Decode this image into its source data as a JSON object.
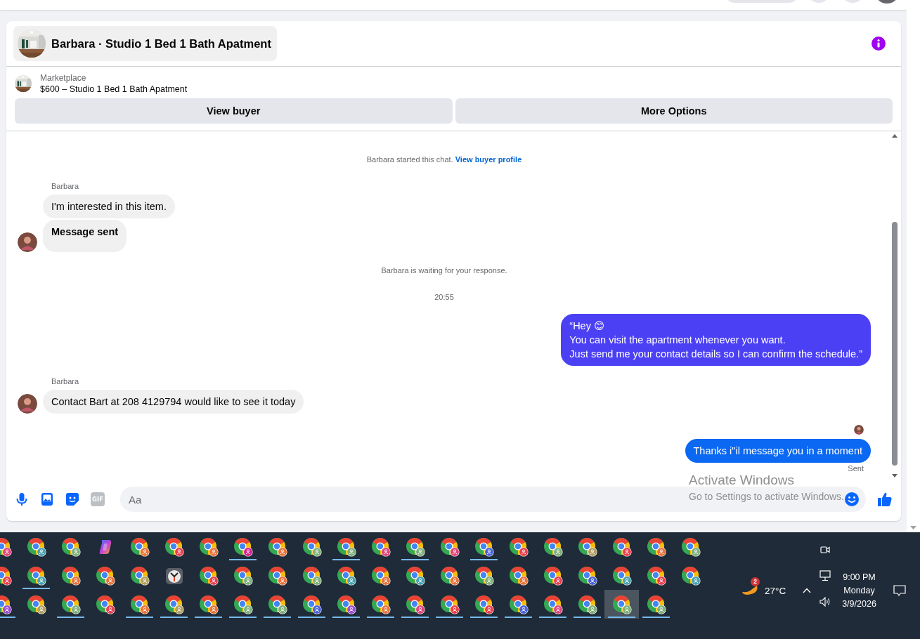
{
  "chat": {
    "title": "Barbara · Studio 1 Bed 1 Bath Apatment",
    "listing": {
      "source": "Marketplace",
      "summary": "$600 – Studio 1 Bed 1 Bath Apatment"
    },
    "buttons": [
      "View buyer",
      "More Options"
    ],
    "messages": [
      {
        "kind": "notice",
        "text": "Barbara started this chat.",
        "link": "View buyer profile"
      },
      {
        "kind": "incoming",
        "sender": "Barbara",
        "bubbles": [
          {
            "text": "I'm interested in this item.",
            "bold": false
          },
          {
            "text": "Message sent",
            "bold": true
          }
        ]
      },
      {
        "kind": "notice",
        "text": "Barbara is waiting for your response."
      },
      {
        "kind": "timestamp",
        "text": "20:55"
      },
      {
        "kind": "outgoing",
        "bubbles": [
          {
            "text": "“Hey 😊\nYou can visit the apartment whenever you want.\nJust send me your contact details so I can confirm the schedule.”",
            "color": "#4c40f4"
          }
        ]
      },
      {
        "kind": "incoming",
        "sender": "Barbara",
        "bubbles": [
          {
            "text": "Contact Bart at 208 4129794 would like to see it today",
            "bold": false
          }
        ]
      },
      {
        "kind": "receipt"
      },
      {
        "kind": "outgoing",
        "bubbles": [
          {
            "text": "Thanks i\"il message you in a moment",
            "color": "#0a68f3"
          }
        ],
        "status": "Sent"
      }
    ],
    "composer": {
      "gif_label": "GIF",
      "placeholder": "Aa"
    }
  },
  "activation_notice": {
    "title": "Activate Windows",
    "subtitle": "Go to Settings to activate Windows."
  },
  "taskbar": {
    "rows": [
      {
        "icons": [
          {
            "kind": "chrome",
            "color": "#e0457b",
            "running": false,
            "selected": false
          },
          {
            "kind": "chrome",
            "color": "#4aa3b0",
            "running": false,
            "selected": false
          },
          {
            "kind": "chrome",
            "color": "#7fb07a",
            "running": false,
            "selected": false
          },
          {
            "kind": "copilot",
            "running": false,
            "selected": false
          },
          {
            "kind": "chrome",
            "color": "#e8743b",
            "running": false,
            "selected": false
          },
          {
            "kind": "chrome",
            "color": "#e8404f",
            "running": false,
            "selected": false
          },
          {
            "kind": "chrome",
            "color": "#e8743b",
            "running": false,
            "selected": false
          },
          {
            "kind": "chrome",
            "color": "#d6208f",
            "running": true,
            "selected": false
          },
          {
            "kind": "chrome",
            "color": "#e8743b",
            "running": false,
            "selected": false
          },
          {
            "kind": "chrome",
            "color": "#7fb07a",
            "running": false,
            "selected": false
          },
          {
            "kind": "chrome",
            "color": "#7fb07a",
            "running": true,
            "selected": false
          },
          {
            "kind": "chrome",
            "color": "#e0457b",
            "running": false,
            "selected": false
          },
          {
            "kind": "chrome",
            "color": "#7fb07a",
            "running": true,
            "selected": false
          },
          {
            "kind": "chrome",
            "color": "#e0457b",
            "running": false,
            "selected": false
          },
          {
            "kind": "chrome",
            "color": "#4b63d8",
            "running": true,
            "selected": false
          },
          {
            "kind": "chrome",
            "color": "#e8404f",
            "running": false,
            "selected": false
          },
          {
            "kind": "chrome",
            "color": "#7fb07a",
            "running": false,
            "selected": false
          },
          {
            "kind": "chrome",
            "color": "#b0a060",
            "running": false,
            "selected": false
          },
          {
            "kind": "chrome",
            "color": "#e8404f",
            "running": false,
            "selected": false
          },
          {
            "kind": "chrome",
            "color": "#e8743b",
            "running": false,
            "selected": false
          },
          {
            "kind": "chrome",
            "color": "#7fb07a",
            "running": false,
            "selected": false
          }
        ]
      },
      {
        "icons": [
          {
            "kind": "chrome",
            "color": "#e8404f",
            "running": false,
            "selected": false
          },
          {
            "kind": "chrome",
            "color": "#4aa3b0",
            "running": true,
            "selected": false
          },
          {
            "kind": "chrome",
            "color": "#e8743b",
            "running": false,
            "selected": false
          },
          {
            "kind": "chrome",
            "color": "#e8743b",
            "running": false,
            "selected": false
          },
          {
            "kind": "chrome",
            "color": "#b0a060",
            "running": false,
            "selected": false
          },
          {
            "kind": "clock",
            "running": false,
            "selected": false
          },
          {
            "kind": "chrome",
            "color": "#e8404f",
            "running": false,
            "selected": false
          },
          {
            "kind": "chrome",
            "color": "#7fb07a",
            "running": false,
            "selected": false
          },
          {
            "kind": "chrome",
            "color": "#e8743b",
            "running": false,
            "selected": false
          },
          {
            "kind": "chrome",
            "color": "#7fb07a",
            "running": false,
            "selected": false
          },
          {
            "kind": "chrome",
            "color": "#4aa3b0",
            "running": false,
            "selected": false
          },
          {
            "kind": "chrome",
            "color": "#e8743b",
            "running": false,
            "selected": false
          },
          {
            "kind": "chrome",
            "color": "#4aa3b0",
            "running": false,
            "selected": false
          },
          {
            "kind": "chrome",
            "color": "#e8743b",
            "running": false,
            "selected": false
          },
          {
            "kind": "chrome",
            "color": "#7fb07a",
            "running": false,
            "selected": false
          },
          {
            "kind": "chrome",
            "color": "#e8743b",
            "running": false,
            "selected": false
          },
          {
            "kind": "chrome",
            "color": "#e8404f",
            "running": false,
            "selected": false
          },
          {
            "kind": "chrome",
            "color": "#4b63d8",
            "running": false,
            "selected": false
          },
          {
            "kind": "chrome",
            "color": "#4aa3b0",
            "running": false,
            "selected": false
          },
          {
            "kind": "chrome",
            "color": "#e8404f",
            "running": false,
            "selected": false
          },
          {
            "kind": "chrome",
            "color": "#4aa3b0",
            "running": false,
            "selected": false
          }
        ]
      },
      {
        "icons": [
          {
            "kind": "chrome",
            "color": "#9b4fd0",
            "running": true,
            "selected": false
          },
          {
            "kind": "chrome",
            "color": "#b0a060",
            "running": false,
            "selected": false
          },
          {
            "kind": "chrome",
            "color": "#7fb07a",
            "running": true,
            "selected": false
          },
          {
            "kind": "chrome",
            "color": "#e8404f",
            "running": false,
            "selected": false
          },
          {
            "kind": "chrome",
            "color": "#e8743b",
            "running": true,
            "selected": false
          },
          {
            "kind": "chrome",
            "color": "#b0a060",
            "running": true,
            "selected": false
          },
          {
            "kind": "chrome",
            "color": "#e8743b",
            "running": true,
            "selected": false
          },
          {
            "kind": "chrome",
            "color": "#7fb07a",
            "running": true,
            "selected": false
          },
          {
            "kind": "chrome",
            "color": "#7fb07a",
            "running": true,
            "selected": false
          },
          {
            "kind": "chrome",
            "color": "#4b63d8",
            "running": true,
            "selected": false
          },
          {
            "kind": "chrome",
            "color": "#9b4fd0",
            "running": true,
            "selected": false
          },
          {
            "kind": "chrome",
            "color": "#e8743b",
            "running": true,
            "selected": false
          },
          {
            "kind": "chrome",
            "color": "#e0457b",
            "running": true,
            "selected": false
          },
          {
            "kind": "chrome",
            "color": "#e8404f",
            "running": true,
            "selected": false
          },
          {
            "kind": "chrome",
            "color": "#e8404f",
            "running": true,
            "selected": false
          },
          {
            "kind": "chrome",
            "color": "#4b63d8",
            "running": true,
            "selected": false
          },
          {
            "kind": "chrome",
            "color": "#e0457b",
            "running": true,
            "selected": false
          },
          {
            "kind": "chrome",
            "color": "#7fb07a",
            "running": true,
            "selected": false
          },
          {
            "kind": "chrome",
            "color": "#7fb07a",
            "running": true,
            "selected": true
          },
          {
            "kind": "chrome",
            "color": "#7fb07a",
            "running": true,
            "selected": false
          }
        ]
      }
    ],
    "tray": {
      "weather_badge": "2",
      "temperature": "27°C",
      "time": "9:00 PM",
      "day": "Monday",
      "date": "3/9/2026"
    }
  }
}
